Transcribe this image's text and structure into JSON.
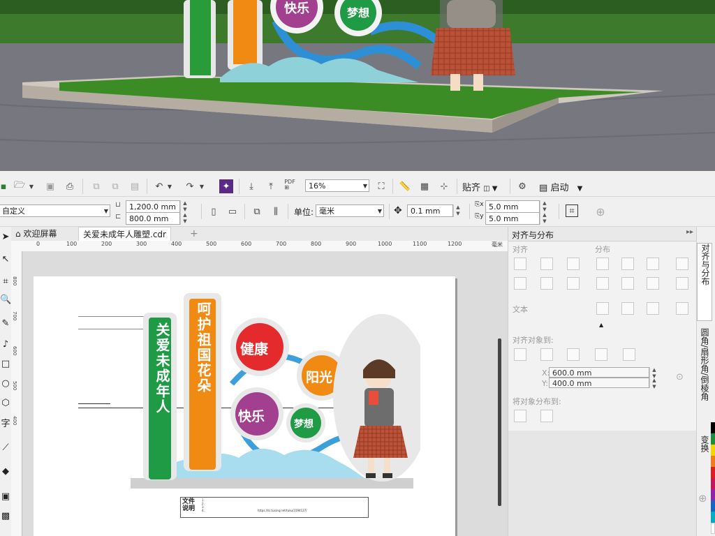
{
  "scene": {
    "photo_labels": {
      "circle_happy": "快乐",
      "circle_dream": "梦想"
    }
  },
  "toolbar1": {
    "zoom_value": "16%",
    "snap_label": "贴齐",
    "launch_label": "启动"
  },
  "toolbar2": {
    "preset_value": "自定义",
    "width_value": "1,200.0 mm",
    "height_value": "800.0 mm",
    "units_label": "单位:",
    "units_value": "毫米",
    "nudge_value": "0.1 mm",
    "dup_x_value": "5.0 mm",
    "dup_y_value": "5.0 mm"
  },
  "tabs": [
    {
      "label": "欢迎屏幕"
    },
    {
      "label": "关爱未成年人雕塑.cdr"
    }
  ],
  "ruler": {
    "ticks": [
      "0",
      "100",
      "200",
      "300",
      "400",
      "500",
      "600",
      "700",
      "800",
      "900",
      "1000",
      "1100",
      "1200"
    ],
    "unit": "毫米",
    "vticks": [
      "800",
      "700",
      "600",
      "500",
      "400"
    ]
  },
  "design": {
    "pillar1": "关爱未成年人",
    "pillar2": "呵护祖国花朵",
    "circle1": "健康",
    "circle2": "阳光",
    "circle3": "快乐",
    "circle4": "梦想",
    "note_title": "文件说明",
    "note_lines": [
      "1.",
      "2.",
      "3.",
      "4."
    ],
    "note_url": "https://tc.tuxinq.net/tuku/3194127/"
  },
  "docker": {
    "title": "对齐与分布",
    "align_label": "对齐",
    "distribute_label": "分布",
    "text_label": "文本",
    "align_to_label": "对齐对象到:",
    "x_value": "600.0 mm",
    "y_value": "400.0 mm",
    "distribute_to_label": "将对象分布到:"
  },
  "side_tabs": [
    {
      "label": "对齐与分布"
    },
    {
      "label": "圆角/扇形角/倒棱角"
    },
    {
      "label": "变换"
    }
  ],
  "colors": {
    "green": "#1f9a45",
    "orange": "#f08a12",
    "red": "#e52a2e",
    "purple": "#a23f8e",
    "blue": "#3b9fdc",
    "skyblue": "#a8dcef"
  }
}
